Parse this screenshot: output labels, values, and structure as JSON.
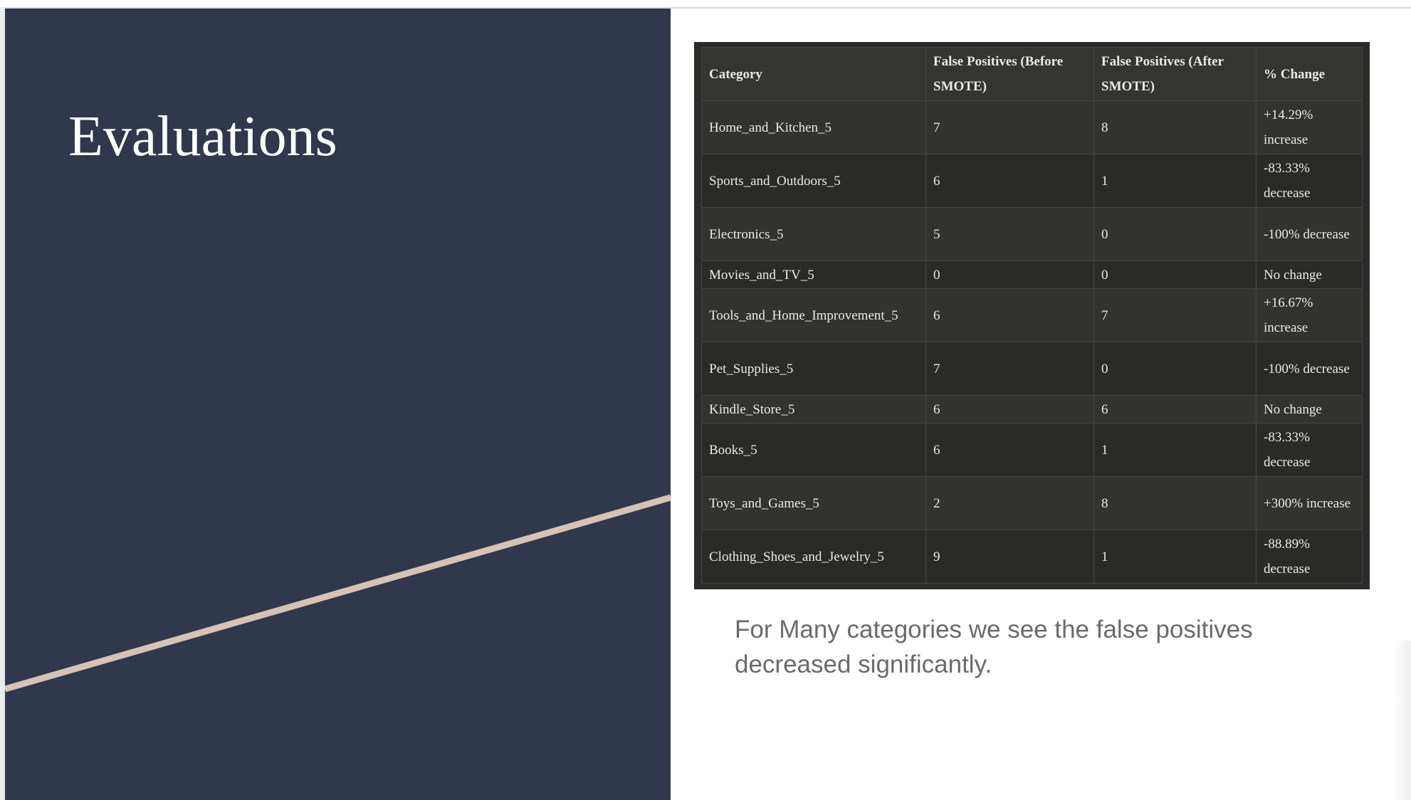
{
  "slide": {
    "title": "Evaluations",
    "caption": "For Many categories we see the false positives decreased significantly."
  },
  "colors": {
    "left_panel": "#31374c",
    "accent_line": "#d5c3b4",
    "table_bg": "#2b2b29",
    "table_text": "#eceae4",
    "caption_text": "#6a6a6a"
  },
  "table": {
    "headers": [
      "Category",
      "False Positives (Before SMOTE)",
      "False Positives (After SMOTE)",
      "% Change"
    ],
    "rows": [
      [
        "Home_and_Kitchen_5",
        "7",
        "8",
        "+14.29% increase"
      ],
      [
        "Sports_and_Outdoors_5",
        "6",
        "1",
        "-83.33% decrease"
      ],
      [
        "Electronics_5",
        "5",
        "0",
        "-100% decrease"
      ],
      [
        "Movies_and_TV_5",
        "0",
        "0",
        "No change"
      ],
      [
        "Tools_and_Home_Improvement_5",
        "6",
        "7",
        "+16.67% increase"
      ],
      [
        "Pet_Supplies_5",
        "7",
        "0",
        "-100% decrease"
      ],
      [
        "Kindle_Store_5",
        "6",
        "6",
        "No change"
      ],
      [
        "Books_5",
        "6",
        "1",
        "-83.33% decrease"
      ],
      [
        "Toys_and_Games_5",
        "2",
        "8",
        "+300% increase"
      ],
      [
        "Clothing_Shoes_and_Jewelry_5",
        "9",
        "1",
        "-88.89% decrease"
      ]
    ]
  }
}
